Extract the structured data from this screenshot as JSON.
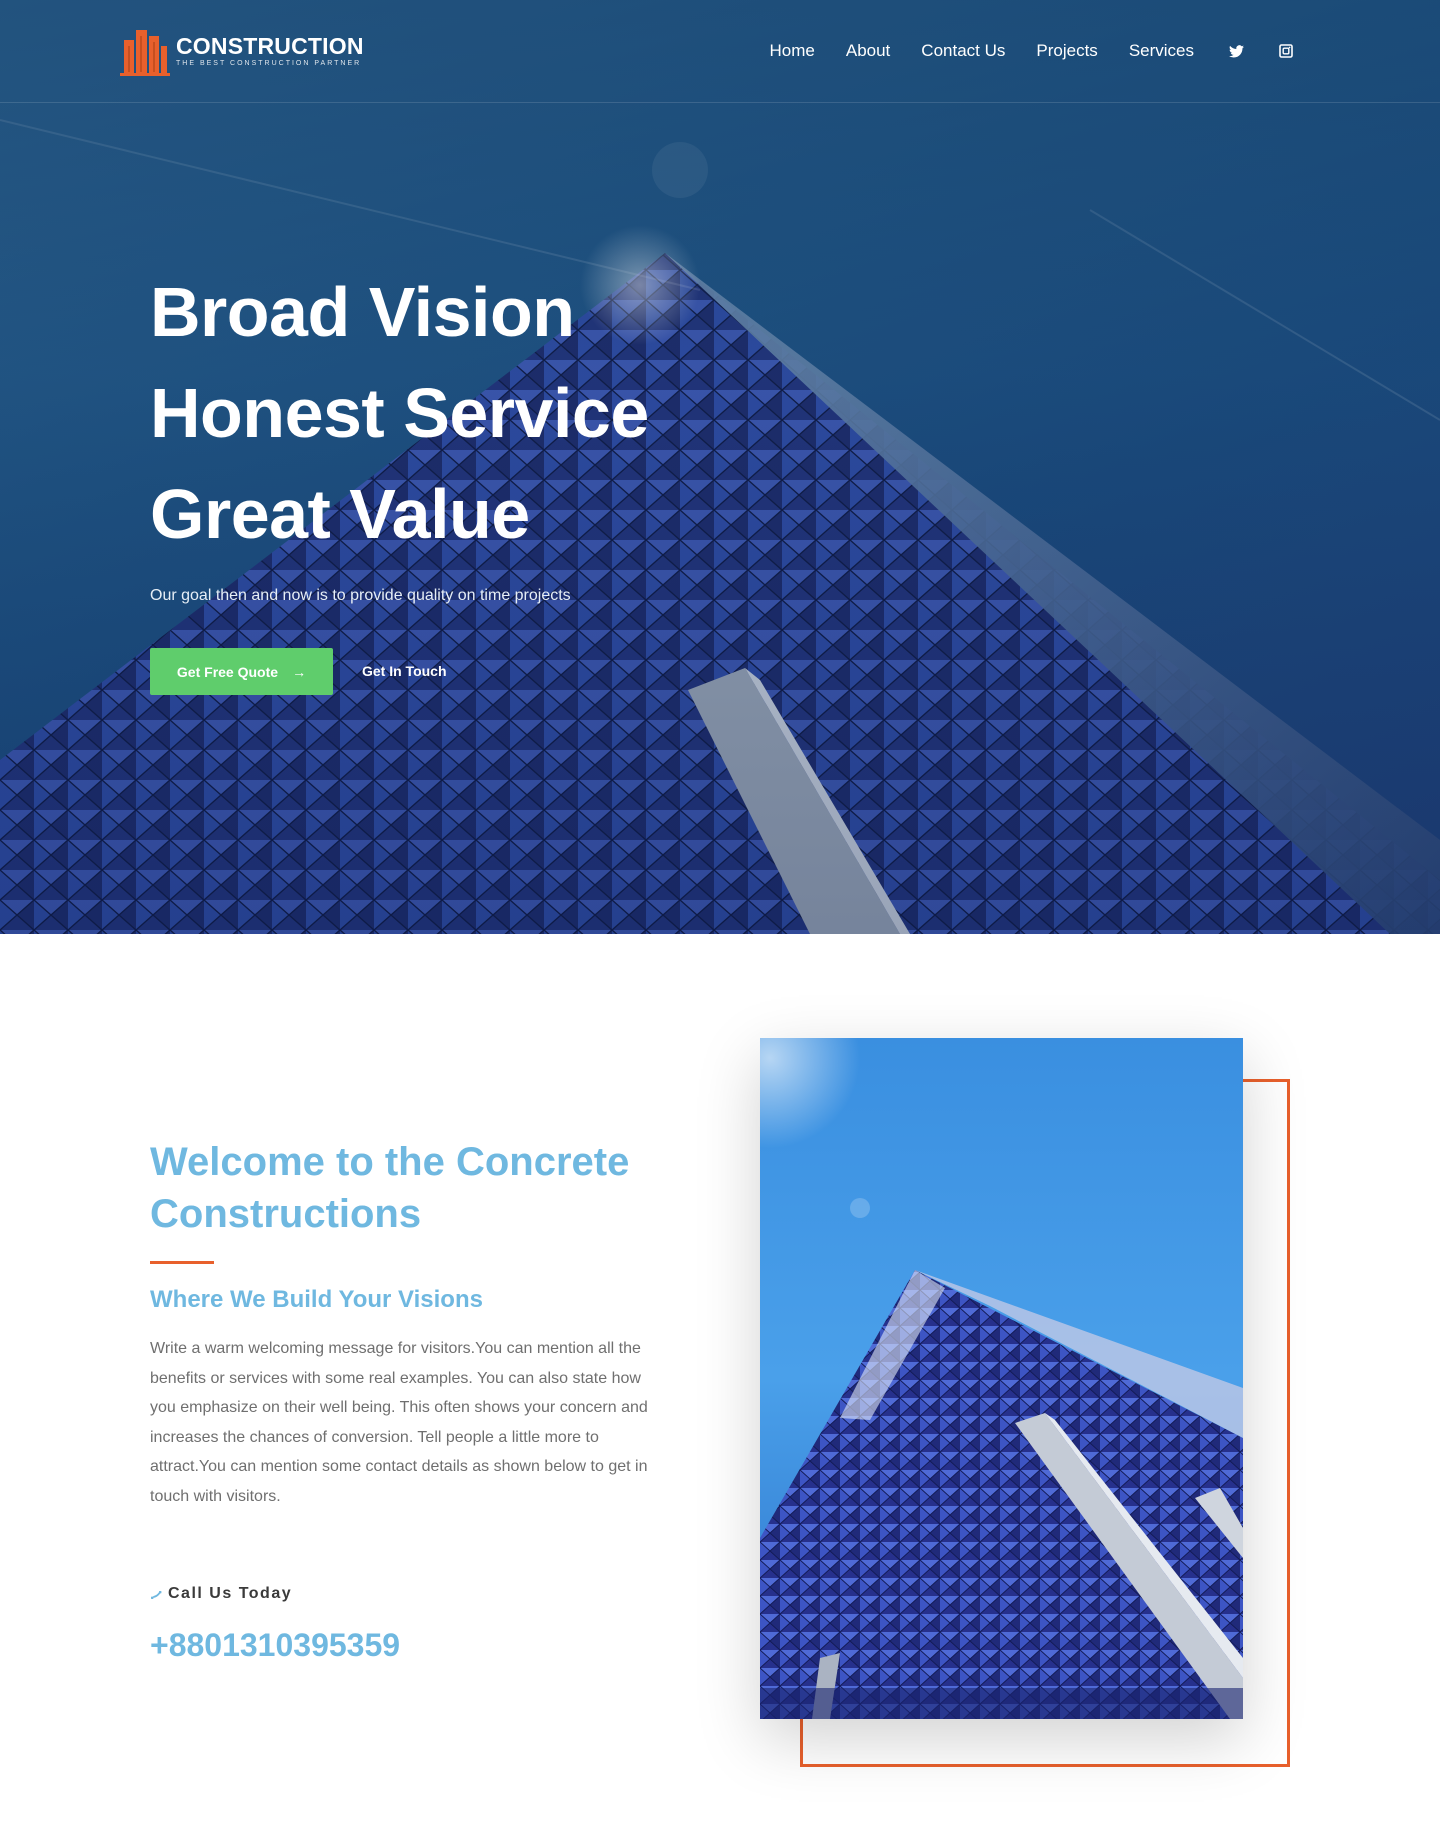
{
  "brand": {
    "name": "CONSTRUCTION",
    "tagline": "THE BEST CONSTRUCTION PARTNER",
    "accent_color": "#e8602c"
  },
  "nav": {
    "items": [
      {
        "label": "Home"
      },
      {
        "label": "About"
      },
      {
        "label": "Contact Us"
      },
      {
        "label": "Projects"
      },
      {
        "label": "Services"
      }
    ],
    "social_icons": [
      "twitter-icon",
      "instagram-icon"
    ]
  },
  "hero": {
    "title_lines": [
      "Broad Vision",
      "Honest Service",
      "Great Value"
    ],
    "subtitle": "Our goal then and now is to provide quality on time projects",
    "primary_button": {
      "label": "Get Free Quote",
      "icon": "arrow-right-icon",
      "color": "#5fcd6c"
    },
    "secondary_button": {
      "label": "Get In Touch"
    }
  },
  "welcome": {
    "title": "Welcome to the Concrete Constructions",
    "subtitle": "Where We Build Your Visions",
    "body": "Write a warm welcoming message for visitors.You can mention all the benefits or services with some real examples. You can also state how you emphasize on their well being. This often shows your concern and increases the chances of conversion. Tell people a little more to attract.You can mention some contact details as shown below to get in touch with visitors.",
    "call_label": "Call Us Today",
    "call_icon": "phone-icon",
    "phone": "+8801310395359",
    "heading_color": "#6fb8e0"
  }
}
